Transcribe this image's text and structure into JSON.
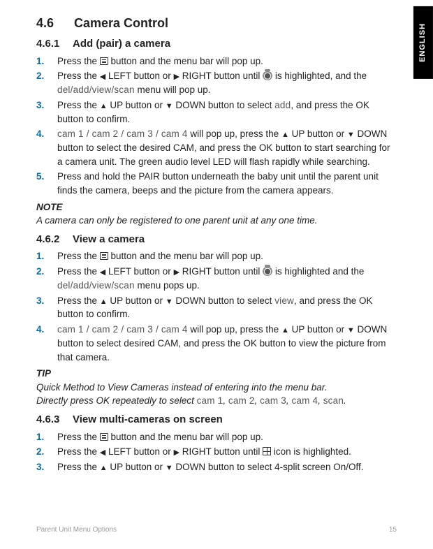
{
  "lang_tab": "ENGLISH",
  "h1": {
    "num": "4.6",
    "title": "Camera Control"
  },
  "s461": {
    "num": "4.6.1",
    "title": "Add (pair) a camera",
    "steps": [
      {
        "n": "1.",
        "pre": "Press the ",
        "post": " button and the menu bar will pop up."
      },
      {
        "n": "2.",
        "a": "Press the ",
        "b": " LEFT button or ",
        "c": " RIGHT button until ",
        "d": " is highlighted, and the ",
        "menu": "del/add/view/scan",
        "e": " menu will pop up."
      },
      {
        "n": "3.",
        "a": "Press the ",
        "b": " UP button or ",
        "c": " DOWN button to select ",
        "menu": "add",
        "d": ", and press the OK button to confirm."
      },
      {
        "n": "4.",
        "menu": "cam 1 / cam 2 / cam 3 / cam 4",
        "a": " will pop up, press the ",
        "b": " UP button or ",
        "c": " DOWN button to select the desired CAM, and press the OK button to start searching for a camera unit. The green audio level LED will flash rapidly while searching."
      },
      {
        "n": "5.",
        "text": "Press and hold the PAIR button underneath the baby unit until the parent unit finds the camera, beeps and the picture from the camera appears."
      }
    ],
    "note_label": "NOTE",
    "note_body": "A camera can only be registered to one parent unit at any one time."
  },
  "s462": {
    "num": "4.6.2",
    "title": "View a camera",
    "steps": [
      {
        "n": "1.",
        "pre": "Press the ",
        "post": " button and the menu bar will pop up."
      },
      {
        "n": "2.",
        "a": "Press the ",
        "b": " LEFT button or ",
        "c": " RIGHT button until ",
        "d": " is highlighted and the ",
        "menu": "del/add/view/scan",
        "e": " menu pops up."
      },
      {
        "n": "3.",
        "a": "Press the ",
        "b": " UP button or ",
        "c": " DOWN button to select ",
        "menu": "view",
        "d": ", and press the OK button to confirm."
      },
      {
        "n": "4.",
        "menu": "cam 1 / cam 2 / cam 3 / cam 4",
        "a": " will pop up, press the ",
        "b": " UP button or ",
        "c": " DOWN button to select desired CAM, and press the OK button to view the picture from that camera."
      }
    ],
    "tip_label": "TIP",
    "tip_line1": "Quick Method to View Cameras instead of entering into the menu bar.",
    "tip_line2_a": "Directly press OK repeatedly to select ",
    "tip_cams": [
      "cam 1",
      "cam 2",
      "cam 3",
      "cam 4",
      "scan"
    ]
  },
  "s463": {
    "num": "4.6.3",
    "title": "View multi-cameras on screen",
    "steps": [
      {
        "n": "1.",
        "pre": "Press the ",
        "post": " button and the menu bar will pop up."
      },
      {
        "n": "2.",
        "a": "Press the ",
        "b": " LEFT button or ",
        "c": " RIGHT button until ",
        "d": " icon is highlighted."
      },
      {
        "n": "3.",
        "a": "Press the ",
        "b": " UP button or ",
        "c": " DOWN button to select 4-split screen On/Off."
      }
    ]
  },
  "footer": {
    "title": "Parent Unit Menu Options",
    "page": "15"
  },
  "glyph": {
    "left": "◀",
    "right": "▶",
    "up": "▲",
    "down": "▼"
  },
  "sep": ", ",
  "dot": "."
}
